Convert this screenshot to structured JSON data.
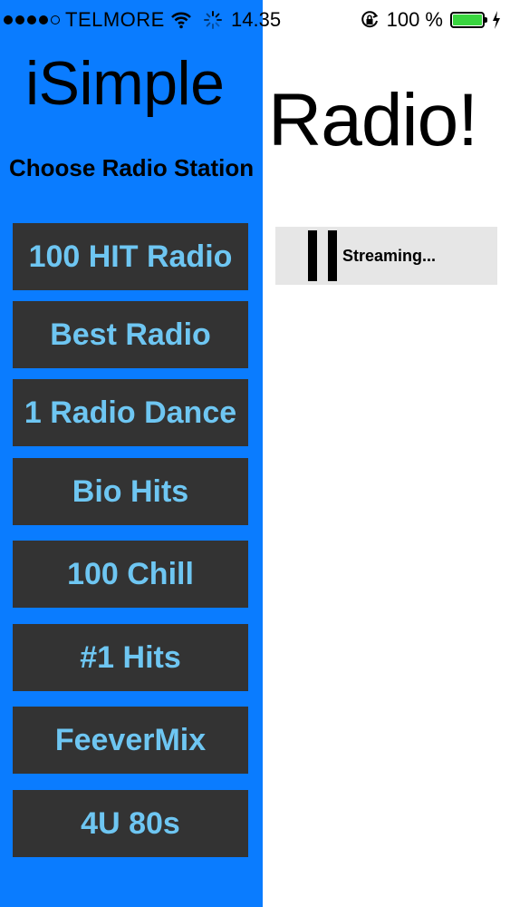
{
  "status_bar": {
    "carrier": "TELMORE",
    "time": "14.35",
    "battery_percent": "100 %",
    "battery_color": "#39d53f"
  },
  "header": {
    "title_left": "iSimple",
    "title_right": "Radio!",
    "subtitle": "Choose Radio Station"
  },
  "stations": [
    {
      "label": "100 HIT Radio"
    },
    {
      "label": "Best Radio"
    },
    {
      "label": "1 Radio Dance"
    },
    {
      "label": "Bio Hits"
    },
    {
      "label": "100 Chill"
    },
    {
      "label": "#1 Hits"
    },
    {
      "label": "FeeverMix"
    },
    {
      "label": "4U 80s"
    }
  ],
  "player": {
    "status_text": "Streaming..."
  },
  "colors": {
    "panel_blue": "#0a7cff",
    "button_bg": "#333333",
    "button_text": "#6ec6f2",
    "player_bg": "#e6e6e6"
  },
  "icons": [
    "wifi-icon",
    "activity-spinner-icon",
    "orientation-lock-icon",
    "battery-icon",
    "charging-bolt-icon",
    "pause-icon"
  ]
}
